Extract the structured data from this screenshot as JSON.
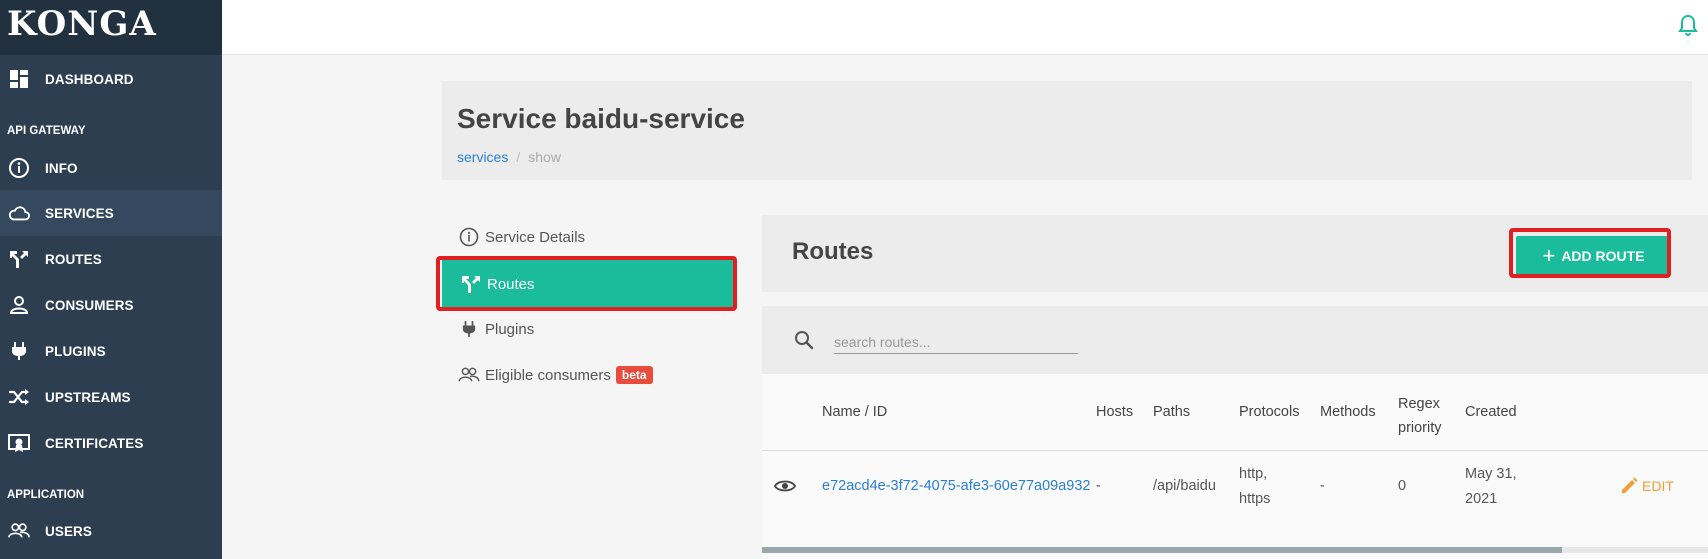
{
  "brand": {
    "logo": "KONGA",
    "accent": "#1abc9c",
    "sidebar_bg": "#2c3e50"
  },
  "sidebar": {
    "items": [
      {
        "label": "DASHBOARD",
        "icon": "dashboard-icon"
      },
      {
        "label": "INFO",
        "icon": "info-icon"
      },
      {
        "label": "SERVICES",
        "icon": "cloud-icon",
        "active": true
      },
      {
        "label": "ROUTES",
        "icon": "routes-icon"
      },
      {
        "label": "CONSUMERS",
        "icon": "user-icon"
      },
      {
        "label": "PLUGINS",
        "icon": "plug-icon"
      },
      {
        "label": "UPSTREAMS",
        "icon": "shuffle-icon"
      },
      {
        "label": "CERTIFICATES",
        "icon": "certificate-icon"
      },
      {
        "label": "USERS",
        "icon": "users-icon"
      }
    ],
    "sections": {
      "api_gateway": "API GATEWAY",
      "application": "APPLICATION"
    }
  },
  "header": {
    "title": "Service baidu-service",
    "breadcrumb": {
      "link": "services",
      "separator": "/",
      "current": "show"
    }
  },
  "tabs": [
    {
      "label": "Service Details",
      "icon": "info-icon"
    },
    {
      "label": "Routes",
      "icon": "routes-icon",
      "active": true
    },
    {
      "label": "Plugins",
      "icon": "plug-icon"
    },
    {
      "label": "Eligible consumers",
      "icon": "users-icon",
      "badge": "beta"
    }
  ],
  "routes": {
    "title": "Routes",
    "add_button": "ADD ROUTE",
    "search_placeholder": "search routes...",
    "columns": [
      "Name / ID",
      "Hosts",
      "Paths",
      "Protocols",
      "Methods",
      "Regex",
      "priority",
      "Created"
    ],
    "rows": [
      {
        "id": "e72acd4e-3f72-4075-afe3-60e77a09a932",
        "hosts": "-",
        "paths": "/api/baidu",
        "protocols_1": "http,",
        "protocols_2": "https",
        "methods": "-",
        "regex_priority": "0",
        "created_1": "May 31,",
        "created_2": "2021",
        "action": "EDIT"
      }
    ]
  }
}
